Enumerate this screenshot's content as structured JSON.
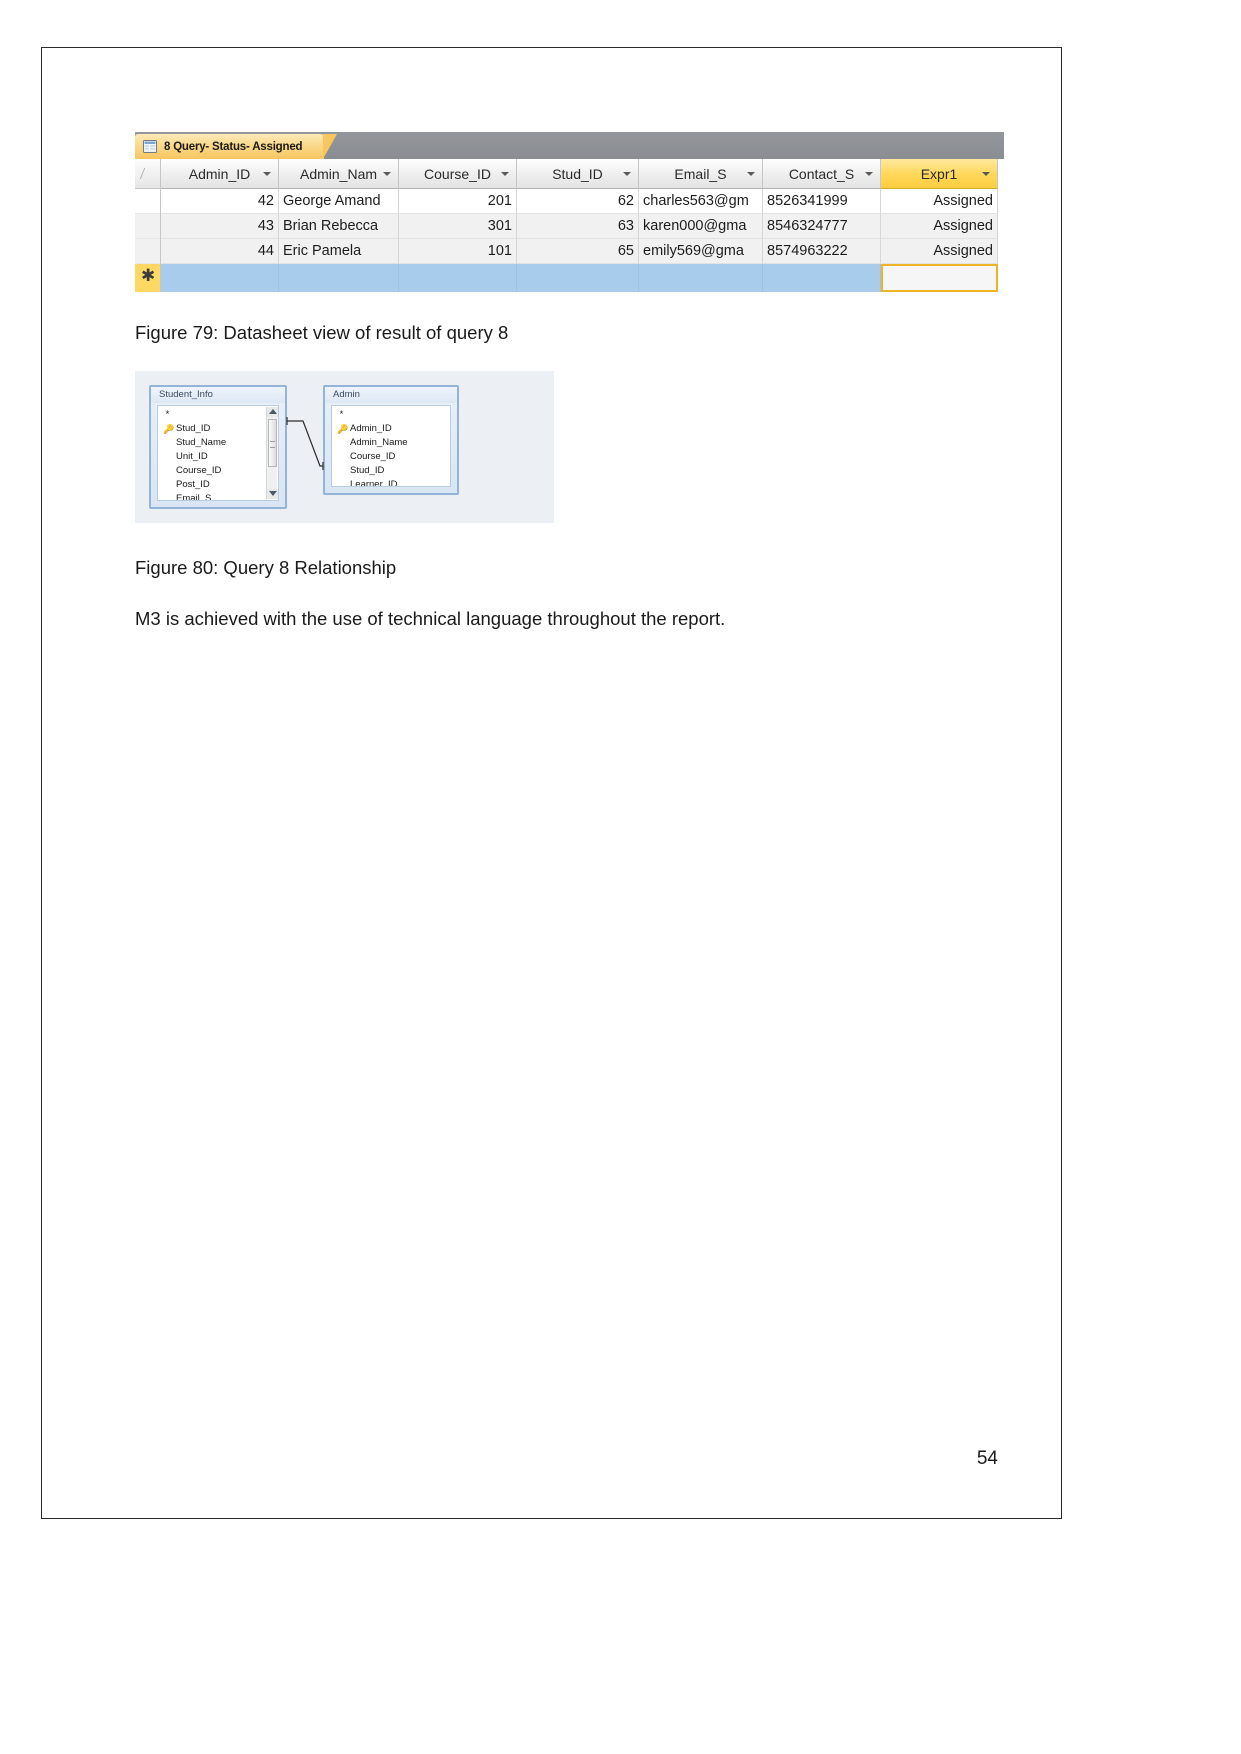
{
  "document": {
    "page_number": "54"
  },
  "figure79": {
    "window": {
      "tab_label": "8 Query- Status- Assigned",
      "tab_icon": "query-datasheet-icon"
    },
    "datasheet": {
      "columns": [
        {
          "name": "Admin_ID",
          "align": "num",
          "selected": false
        },
        {
          "name": "Admin_Nam",
          "align": "txt",
          "selected": false
        },
        {
          "name": "Course_ID",
          "align": "num",
          "selected": false
        },
        {
          "name": "Stud_ID",
          "align": "num",
          "selected": false
        },
        {
          "name": "Email_S",
          "align": "txt",
          "selected": false
        },
        {
          "name": "Contact_S",
          "align": "txt",
          "selected": false
        },
        {
          "name": "Expr1",
          "align": "rt",
          "selected": true
        }
      ],
      "rows": [
        {
          "Admin_ID": "42",
          "Admin_Name": "George Amand",
          "Course_ID": "201",
          "Stud_ID": "62",
          "Email_S": "charles563@gm",
          "Contact_S": "8526341999",
          "Expr1": "Assigned"
        },
        {
          "Admin_ID": "43",
          "Admin_Name": "Brian Rebecca",
          "Course_ID": "301",
          "Stud_ID": "63",
          "Email_S": "karen000@gma",
          "Contact_S": "8546324777",
          "Expr1": "Assigned"
        },
        {
          "Admin_ID": "44",
          "Admin_Name": "Eric Pamela",
          "Course_ID": "101",
          "Stud_ID": "65",
          "Email_S": "emily569@gma",
          "Contact_S": "8574963222",
          "Expr1": "Assigned"
        }
      ],
      "new_record_marker": "✱"
    },
    "caption": "Figure 79: Datasheet view of result of query 8"
  },
  "figure80": {
    "tables": [
      {
        "title": "Student_Info",
        "fields": [
          {
            "label": "*",
            "key": false,
            "star": true
          },
          {
            "label": "Stud_ID",
            "key": true,
            "star": false
          },
          {
            "label": "Stud_Name",
            "key": false,
            "star": false
          },
          {
            "label": "Unit_ID",
            "key": false,
            "star": false
          },
          {
            "label": "Course_ID",
            "key": false,
            "star": false
          },
          {
            "label": "Post_ID",
            "key": false,
            "star": false
          },
          {
            "label": "Email_S",
            "key": false,
            "star": false
          }
        ],
        "has_scrollbar": true
      },
      {
        "title": "Admin",
        "fields": [
          {
            "label": "*",
            "key": false,
            "star": true
          },
          {
            "label": "Admin_ID",
            "key": true,
            "star": false
          },
          {
            "label": "Admin_Name",
            "key": false,
            "star": false
          },
          {
            "label": "Course_ID",
            "key": false,
            "star": false
          },
          {
            "label": "Stud_ID",
            "key": false,
            "star": false
          },
          {
            "label": "Learner_ID",
            "key": false,
            "star": false
          }
        ],
        "has_scrollbar": false
      }
    ],
    "caption": "Figure 80: Query 8 Relationship"
  },
  "paragraph": {
    "text": "M3 is achieved with the use of technical language throughout the report."
  },
  "colors": {
    "tab_accent": "#f7c65f",
    "selected_column": "#ffd758",
    "new_row": "#a8cdec",
    "relationship_border": "#93b4d6"
  }
}
